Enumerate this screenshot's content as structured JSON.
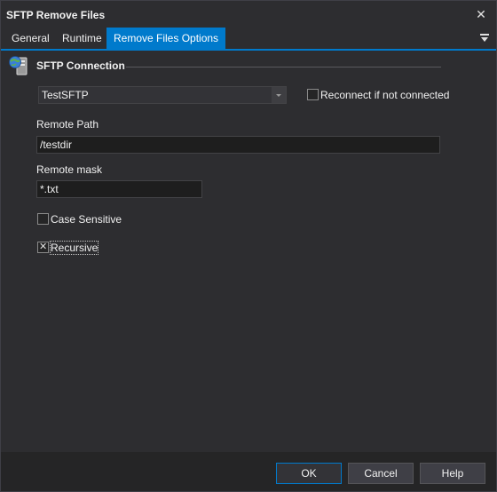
{
  "window": {
    "title": "SFTP Remove Files"
  },
  "tabs": [
    {
      "label": "General"
    },
    {
      "label": "Runtime"
    },
    {
      "label": "Remove Files Options",
      "active": true
    }
  ],
  "section": {
    "title": "SFTP Connection",
    "icon": "server-globe-icon"
  },
  "connection": {
    "selected": "TestSFTP",
    "reconnect_label": "Reconnect if not connected",
    "reconnect_checked": false
  },
  "remote_path": {
    "label": "Remote Path",
    "value": "/testdir"
  },
  "remote_mask": {
    "label": "Remote mask",
    "value": "*.txt"
  },
  "case_sensitive": {
    "label": "Case Sensitive",
    "checked": false
  },
  "recursive": {
    "label": "Recursive",
    "checked": true
  },
  "buttons": {
    "ok": "OK",
    "cancel": "Cancel",
    "help": "Help"
  },
  "colors": {
    "accent": "#007acc",
    "background": "#2d2d30",
    "footer": "#252526"
  }
}
